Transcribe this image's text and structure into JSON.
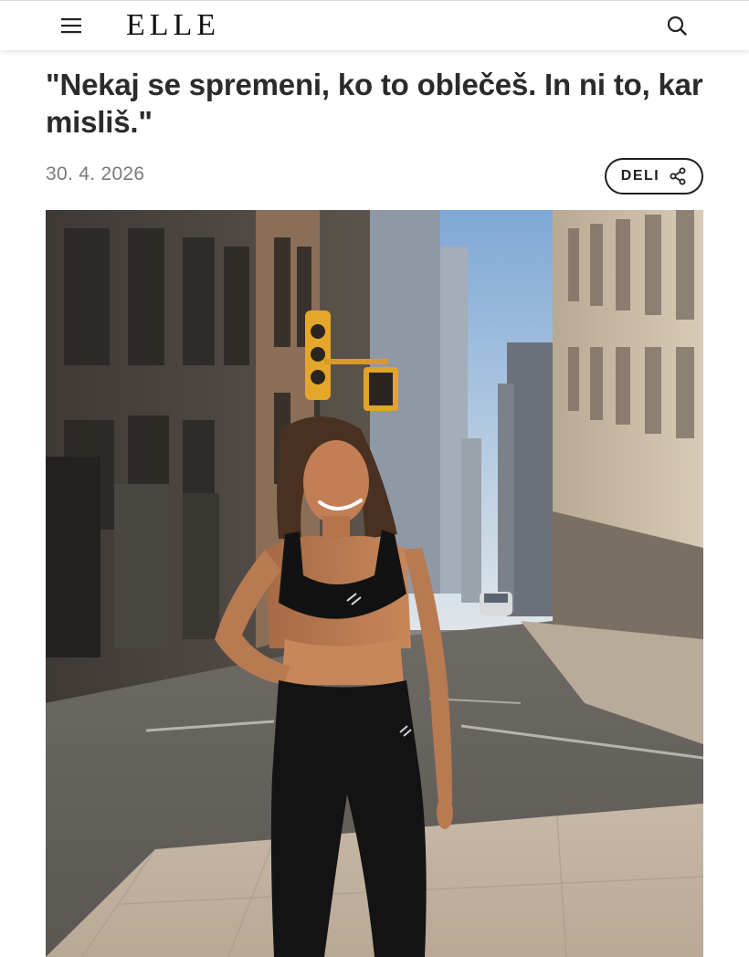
{
  "header": {
    "logo_text": "ELLE",
    "menu_icon": "hamburger-menu-icon",
    "search_icon": "search-icon"
  },
  "article": {
    "title": "\"Nekaj se spremeni, ko to oblečeš. In ni to, kar misliš.\"",
    "date": "30. 4. 2026",
    "share_label": "DELI",
    "share_icon": "share-icon"
  },
  "hero_image": {
    "description_icon": "photo"
  },
  "colors": {
    "text_dark": "#2b2b2b",
    "text_muted": "#7a7a7a",
    "border": "#1e1e1e"
  }
}
